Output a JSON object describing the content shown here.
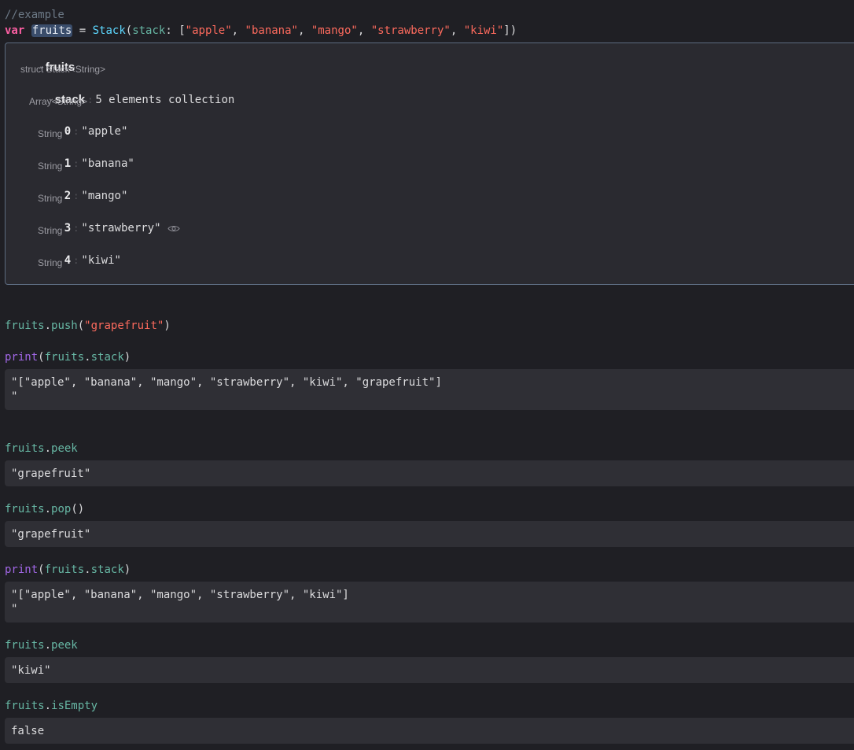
{
  "code": {
    "comment": "//example",
    "decl": {
      "keyword": "var",
      "name": "fruits",
      "eq": " = ",
      "type": "Stack",
      "open": "(",
      "label": "stack",
      "colon": ": [",
      "items": [
        "\"apple\"",
        "\"banana\"",
        "\"mango\"",
        "\"strawberry\"",
        "\"kiwi\""
      ],
      "sep": ", ",
      "close": "])"
    },
    "push_line": {
      "obj": "fruits",
      "dot": ".",
      "method": "push",
      "open": "(",
      "arg": "\"grapefruit\"",
      "close": ")"
    },
    "print1": {
      "fn": "print",
      "open": "(",
      "obj": "fruits",
      "dot": ".",
      "prop": "stack",
      "close": ")"
    },
    "peek1": {
      "obj": "fruits",
      "dot": ".",
      "prop": "peek"
    },
    "pop": {
      "obj": "fruits",
      "dot": ".",
      "method": "pop",
      "parens": "()"
    },
    "print2": {
      "fn": "print",
      "open": "(",
      "obj": "fruits",
      "dot": ".",
      "prop": "stack",
      "close": ")"
    },
    "peek2": {
      "obj": "fruits",
      "dot": ".",
      "prop": "peek"
    },
    "isEmpty": {
      "obj": "fruits",
      "dot": ".",
      "prop": "isEmpty"
    }
  },
  "inspector": {
    "root_name": "fruits",
    "root_type": "struct Stack<String>",
    "child_name": "stack",
    "child_summary": "5 elements collection",
    "child_type": "Array<String>",
    "colon": ":",
    "elements": [
      {
        "index": "0",
        "value": "\"apple\"",
        "type": "String"
      },
      {
        "index": "1",
        "value": "\"banana\"",
        "type": "String"
      },
      {
        "index": "2",
        "value": "\"mango\"",
        "type": "String"
      },
      {
        "index": "3",
        "value": "\"strawberry\"",
        "type": "String"
      },
      {
        "index": "4",
        "value": "\"kiwi\"",
        "type": "String"
      }
    ],
    "icons": {
      "chevron": "chevron-down-icon",
      "quicklook": "eye-icon"
    }
  },
  "results": {
    "print1": "\"[\"apple\", \"banana\", \"mango\", \"strawberry\", \"kiwi\", \"grapefruit\"]\n\"",
    "peek1": "\"grapefruit\"",
    "pop": "\"grapefruit\"",
    "print2": "\"[\"apple\", \"banana\", \"mango\", \"strawberry\", \"kiwi\"]\n\"",
    "peek2": "\"kiwi\"",
    "isEmpty": "false"
  },
  "colors": {
    "background": "#1f1f24",
    "keyword": "#fc5fa3",
    "function": "#a167e6",
    "type": "#5dd8ff",
    "member": "#67b7a4",
    "string": "#fc6a5d",
    "comment": "#6c7986",
    "result_bg": "#2f2f35",
    "inspector_border": "#5c6b80"
  }
}
